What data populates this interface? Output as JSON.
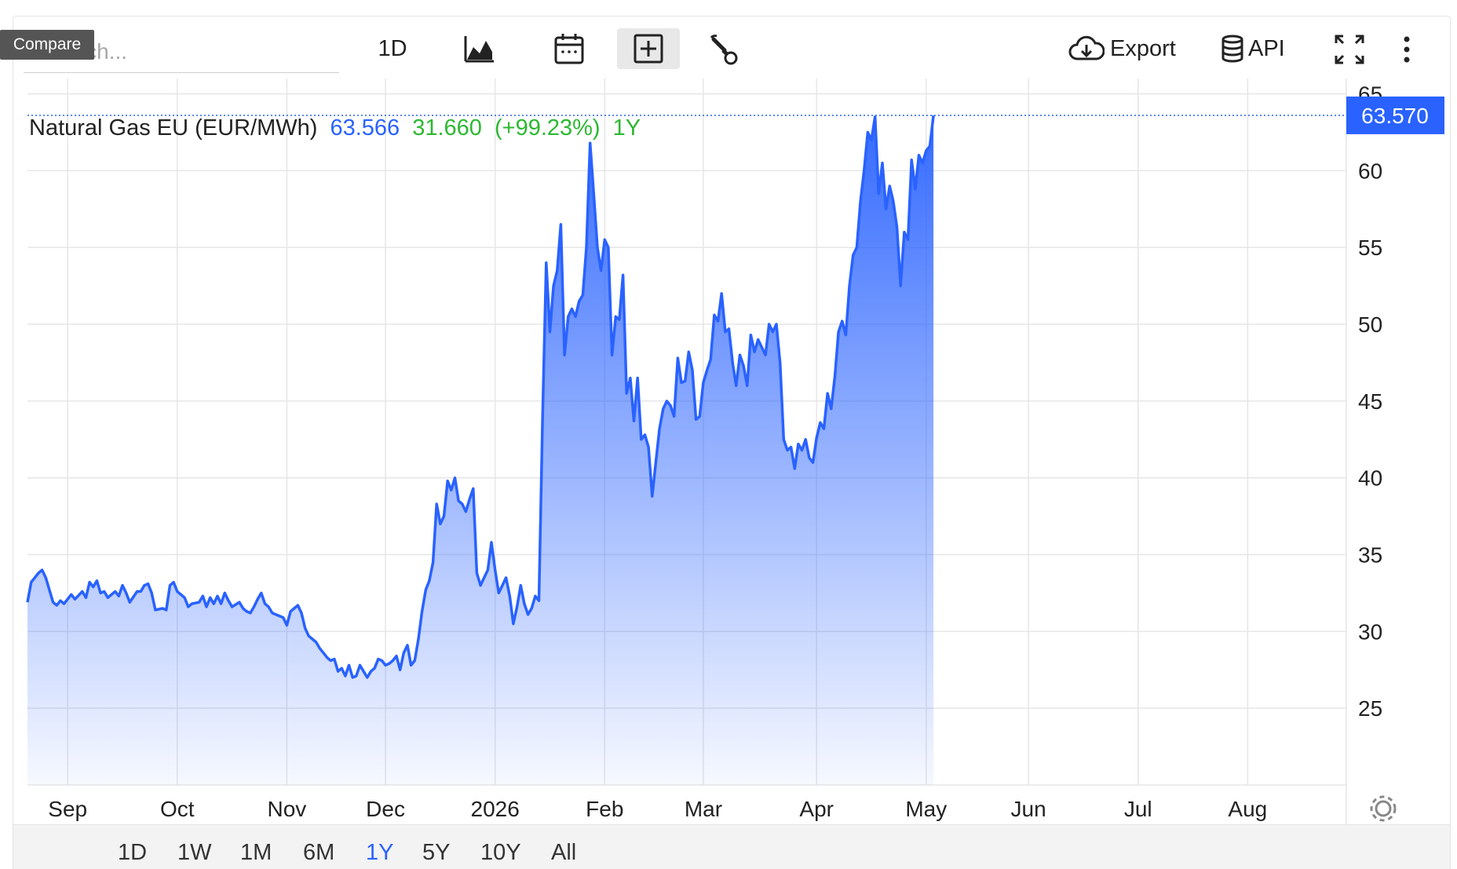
{
  "search": {
    "placeholder": "Search..."
  },
  "tooltip": "Compare",
  "toolbar": {
    "interval_label": "1D",
    "export_label": "Export",
    "api_label": "API",
    "icons": [
      "chart-type-icon",
      "calendar-icon",
      "compare-add-icon",
      "wrench-icon",
      "cloud-download-icon",
      "database-icon",
      "fullscreen-icon",
      "more-vertical-icon"
    ]
  },
  "header": {
    "name": "Natural Gas EU (EUR/MWh)",
    "last": "63.566",
    "change": "31.660",
    "pct": "(+99.23%)",
    "period": "1Y"
  },
  "colors": {
    "accent": "#2962ff",
    "up": "#2db832",
    "line": "#2962ff"
  },
  "ranges": [
    "1D",
    "1W",
    "1M",
    "6M",
    "1Y",
    "5Y",
    "10Y",
    "All"
  ],
  "selected_range": "1Y",
  "chart_data": {
    "type": "area",
    "title": "Natural Gas EU (EUR/MWh)",
    "price_label": "63.570",
    "ylim": [
      20,
      66
    ],
    "yticks": [
      25,
      30,
      35,
      40,
      45,
      50,
      55,
      60,
      65
    ],
    "xlim": [
      0,
      361
    ],
    "xticks": [
      {
        "t": 11,
        "label": "Sep"
      },
      {
        "t": 41,
        "label": "Oct"
      },
      {
        "t": 71,
        "label": "Nov"
      },
      {
        "t": 98,
        "label": "Dec"
      },
      {
        "t": 128,
        "label": "2026"
      },
      {
        "t": 158,
        "label": "Feb"
      },
      {
        "t": 185,
        "label": "Mar"
      },
      {
        "t": 216,
        "label": "Apr"
      },
      {
        "t": 246,
        "label": "May"
      },
      {
        "t": 274,
        "label": "Jun"
      },
      {
        "t": 304,
        "label": "Jul"
      },
      {
        "t": 334,
        "label": "Aug"
      }
    ],
    "grid": true,
    "series": [
      {
        "values": [
          [
            0,
            31.9
          ],
          [
            1,
            33.2
          ],
          [
            3,
            33.8
          ],
          [
            4,
            34.0
          ],
          [
            5,
            33.5
          ],
          [
            7,
            31.9
          ],
          [
            8,
            31.7
          ],
          [
            9,
            32.0
          ],
          [
            10,
            31.8
          ],
          [
            12,
            32.4
          ],
          [
            13,
            32.1
          ],
          [
            15,
            32.6
          ],
          [
            16,
            32.2
          ],
          [
            17,
            33.2
          ],
          [
            18,
            32.9
          ],
          [
            19,
            33.3
          ],
          [
            20,
            32.5
          ],
          [
            21,
            32.6
          ],
          [
            22,
            32.2
          ],
          [
            24,
            32.6
          ],
          [
            25,
            32.3
          ],
          [
            26,
            33.0
          ],
          [
            27,
            32.5
          ],
          [
            28,
            31.9
          ],
          [
            30,
            32.6
          ],
          [
            31,
            32.6
          ],
          [
            32,
            33.0
          ],
          [
            33,
            33.1
          ],
          [
            34,
            32.5
          ],
          [
            35,
            31.4
          ],
          [
            37,
            31.5
          ],
          [
            38,
            31.4
          ],
          [
            39,
            33.0
          ],
          [
            40,
            33.2
          ],
          [
            41,
            32.6
          ],
          [
            43,
            32.2
          ],
          [
            44,
            31.6
          ],
          [
            45,
            31.8
          ],
          [
            47,
            31.9
          ],
          [
            48,
            32.3
          ],
          [
            49,
            31.6
          ],
          [
            50,
            32.2
          ],
          [
            51,
            31.8
          ],
          [
            52,
            32.3
          ],
          [
            53,
            31.8
          ],
          [
            54,
            32.5
          ],
          [
            55,
            32.0
          ],
          [
            56,
            31.6
          ],
          [
            58,
            31.9
          ],
          [
            59,
            31.5
          ],
          [
            60,
            31.3
          ],
          [
            61,
            31.2
          ],
          [
            62,
            31.6
          ],
          [
            63,
            32.1
          ],
          [
            64,
            32.5
          ],
          [
            65,
            31.8
          ],
          [
            66,
            31.6
          ],
          [
            67,
            31.2
          ],
          [
            69,
            31.0
          ],
          [
            70,
            30.9
          ],
          [
            71,
            30.4
          ],
          [
            72,
            31.3
          ],
          [
            73,
            31.5
          ],
          [
            74,
            31.7
          ],
          [
            75,
            31.2
          ],
          [
            76,
            30.2
          ],
          [
            77,
            29.7
          ],
          [
            78,
            29.5
          ],
          [
            79,
            29.3
          ],
          [
            80,
            28.9
          ],
          [
            81,
            28.6
          ],
          [
            82,
            28.3
          ],
          [
            83,
            28.1
          ],
          [
            84,
            28.2
          ],
          [
            85,
            27.4
          ],
          [
            86,
            27.6
          ],
          [
            87,
            27.1
          ],
          [
            88,
            27.8
          ],
          [
            89,
            27.0
          ],
          [
            90,
            27.1
          ],
          [
            91,
            27.8
          ],
          [
            92,
            27.4
          ],
          [
            93,
            27.0
          ],
          [
            94,
            27.4
          ],
          [
            95,
            27.6
          ],
          [
            96,
            28.2
          ],
          [
            97,
            28.1
          ],
          [
            98,
            27.8
          ],
          [
            99,
            27.9
          ],
          [
            100,
            28.1
          ],
          [
            101,
            28.4
          ],
          [
            102,
            27.5
          ],
          [
            103,
            28.6
          ],
          [
            104,
            29.1
          ],
          [
            105,
            27.8
          ],
          [
            106,
            28.1
          ],
          [
            107,
            29.5
          ],
          [
            108,
            31.3
          ],
          [
            109,
            32.7
          ],
          [
            110,
            33.3
          ],
          [
            111,
            34.5
          ],
          [
            112,
            38.3
          ],
          [
            113,
            37.0
          ],
          [
            114,
            37.5
          ],
          [
            115,
            39.8
          ],
          [
            116,
            39.2
          ],
          [
            117,
            40.0
          ],
          [
            118,
            38.5
          ],
          [
            119,
            38.3
          ],
          [
            120,
            37.8
          ],
          [
            121,
            38.6
          ],
          [
            122,
            39.3
          ],
          [
            123,
            33.8
          ],
          [
            124,
            33.0
          ],
          [
            125,
            33.5
          ],
          [
            126,
            34.0
          ],
          [
            127,
            35.8
          ],
          [
            128,
            34.0
          ],
          [
            129,
            32.5
          ],
          [
            130,
            33.0
          ],
          [
            131,
            33.5
          ],
          [
            132,
            32.3
          ],
          [
            133,
            30.5
          ],
          [
            134,
            31.6
          ],
          [
            135,
            33.0
          ],
          [
            136,
            31.8
          ],
          [
            137,
            31.1
          ],
          [
            138,
            31.5
          ],
          [
            139,
            32.3
          ],
          [
            140,
            32.0
          ],
          [
            141,
            44.0
          ],
          [
            142,
            54.0
          ],
          [
            143,
            49.5
          ],
          [
            144,
            52.5
          ],
          [
            145,
            53.5
          ],
          [
            146,
            56.5
          ],
          [
            147,
            48.0
          ],
          [
            148,
            50.5
          ],
          [
            149,
            51.0
          ],
          [
            150,
            50.5
          ],
          [
            151,
            51.5
          ],
          [
            152,
            51.9
          ],
          [
            153,
            55.0
          ],
          [
            154,
            61.8
          ],
          [
            155,
            58.5
          ],
          [
            156,
            55.0
          ],
          [
            157,
            53.5
          ],
          [
            158,
            55.5
          ],
          [
            159,
            55.0
          ],
          [
            160,
            48.0
          ],
          [
            161,
            50.5
          ],
          [
            162,
            50.3
          ],
          [
            163,
            53.2
          ],
          [
            164,
            45.5
          ],
          [
            165,
            46.5
          ],
          [
            166,
            43.7
          ],
          [
            167,
            46.5
          ],
          [
            168,
            42.5
          ],
          [
            169,
            42.8
          ],
          [
            170,
            42.0
          ],
          [
            171,
            38.8
          ],
          [
            172,
            41.0
          ],
          [
            173,
            43.2
          ],
          [
            174,
            44.5
          ],
          [
            175,
            45.0
          ],
          [
            176,
            44.7
          ],
          [
            177,
            44.0
          ],
          [
            178,
            47.8
          ],
          [
            179,
            46.2
          ],
          [
            180,
            46.3
          ],
          [
            181,
            48.2
          ],
          [
            182,
            47.0
          ],
          [
            183,
            43.8
          ],
          [
            184,
            44.0
          ],
          [
            185,
            46.2
          ],
          [
            186,
            47.0
          ],
          [
            187,
            47.7
          ],
          [
            188,
            50.6
          ],
          [
            189,
            50.2
          ],
          [
            190,
            52.0
          ],
          [
            191,
            49.5
          ],
          [
            192,
            49.7
          ],
          [
            193,
            47.5
          ],
          [
            194,
            46.0
          ],
          [
            195,
            48.0
          ],
          [
            196,
            47.3
          ],
          [
            197,
            46.0
          ],
          [
            198,
            49.3
          ],
          [
            199,
            48.2
          ],
          [
            200,
            49.0
          ],
          [
            201,
            48.5
          ],
          [
            202,
            48.0
          ],
          [
            203,
            50.0
          ],
          [
            204,
            49.5
          ],
          [
            205,
            50.0
          ],
          [
            206,
            47.5
          ],
          [
            207,
            42.5
          ],
          [
            208,
            41.8
          ],
          [
            209,
            42.0
          ],
          [
            210,
            40.6
          ],
          [
            211,
            42.2
          ],
          [
            212,
            41.8
          ],
          [
            213,
            42.5
          ],
          [
            214,
            41.3
          ],
          [
            215,
            41.0
          ],
          [
            216,
            42.6
          ],
          [
            217,
            43.6
          ],
          [
            218,
            43.2
          ],
          [
            219,
            45.5
          ],
          [
            220,
            44.5
          ],
          [
            221,
            46.6
          ],
          [
            222,
            49.5
          ],
          [
            223,
            50.2
          ],
          [
            224,
            49.3
          ],
          [
            225,
            52.5
          ],
          [
            226,
            54.5
          ],
          [
            227,
            55.0
          ],
          [
            228,
            58.0
          ],
          [
            229,
            60.0
          ],
          [
            230,
            62.5
          ],
          [
            231,
            62.0
          ],
          [
            232,
            63.5
          ],
          [
            233,
            58.5
          ],
          [
            234,
            60.5
          ],
          [
            235,
            57.5
          ],
          [
            236,
            59.0
          ],
          [
            237,
            58.0
          ],
          [
            238,
            56.3
          ],
          [
            239,
            52.5
          ],
          [
            240,
            56.0
          ],
          [
            241,
            55.5
          ],
          [
            242,
            60.7
          ],
          [
            243,
            58.8
          ],
          [
            244,
            61.0
          ],
          [
            245,
            60.5
          ],
          [
            246,
            61.3
          ],
          [
            247,
            61.6
          ],
          [
            248,
            63.6
          ]
        ]
      }
    ]
  }
}
